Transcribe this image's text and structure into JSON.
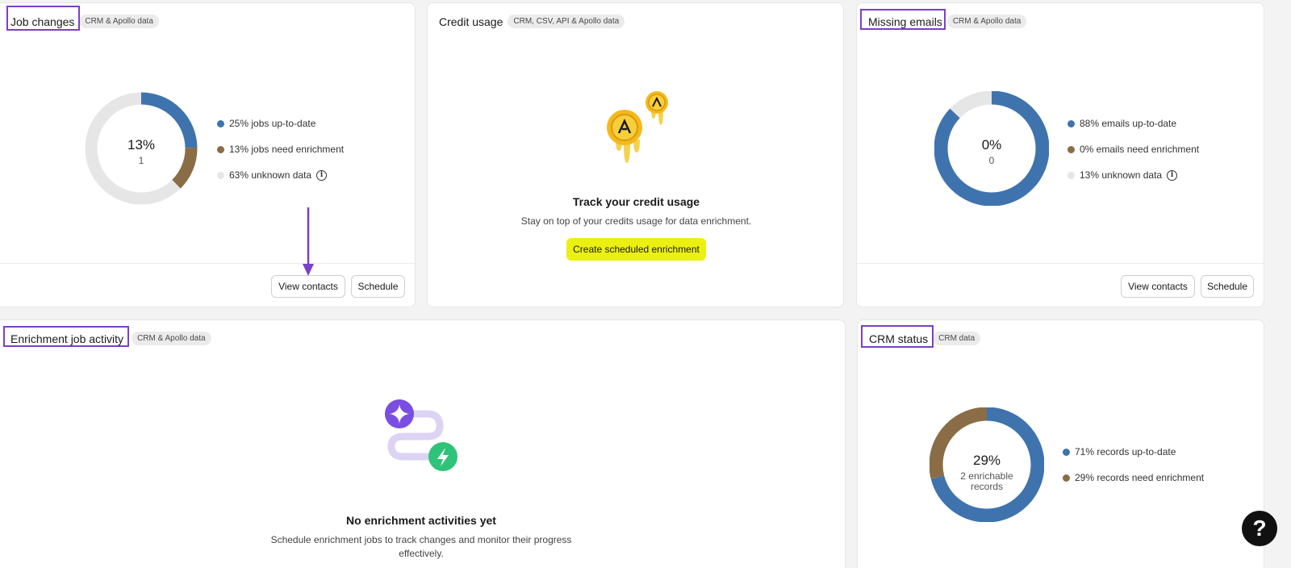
{
  "job_changes": {
    "title": "Job changes",
    "tag": "CRM & Apollo data",
    "center_pct": "13%",
    "center_count": "1",
    "legend": [
      {
        "label": "25% jobs up-to-date",
        "color": "#3f73ae"
      },
      {
        "label": "13% jobs need enrichment",
        "color": "#8a6d46"
      },
      {
        "label": "63% unknown data",
        "color": "#e6e6e6"
      }
    ],
    "chart_data": {
      "type": "pie",
      "categories": [
        "jobs up-to-date",
        "jobs need enrichment",
        "unknown data"
      ],
      "values": [
        25,
        13,
        63
      ]
    },
    "view_contacts_label": "View contacts",
    "schedule_label": "Schedule"
  },
  "credit_usage": {
    "title": "Credit usage",
    "tag": "CRM, CSV, API & Apollo data",
    "empty_title": "Track your credit usage",
    "empty_desc": "Stay on top of your credits usage for data enrichment.",
    "cta_label": "Create scheduled enrichment"
  },
  "missing_emails": {
    "title": "Missing emails",
    "tag": "CRM & Apollo data",
    "center_pct": "0%",
    "center_count": "0",
    "legend": [
      {
        "label": "88% emails up-to-date",
        "color": "#3f73ae"
      },
      {
        "label": "0% emails need enrichment",
        "color": "#8a6d46"
      },
      {
        "label": "13% unknown data",
        "color": "#e6e6e6"
      }
    ],
    "chart_data": {
      "type": "pie",
      "categories": [
        "emails up-to-date",
        "emails need enrichment",
        "unknown data"
      ],
      "values": [
        88,
        0,
        13
      ]
    },
    "view_contacts_label": "View contacts",
    "schedule_label": "Schedule"
  },
  "enrichment_activity": {
    "title": "Enrichment job activity",
    "tag": "CRM & Apollo data",
    "empty_title": "No enrichment activities yet",
    "empty_desc": "Schedule enrichment jobs to track changes and monitor their progress effectively."
  },
  "crm_status": {
    "title": "CRM status",
    "tag": "CRM data",
    "center_pct": "29%",
    "center_sub": "2 enrichable records",
    "legend": [
      {
        "label": "71% records up-to-date",
        "color": "#3f73ae"
      },
      {
        "label": "29% records need enrichment",
        "color": "#8a6d46"
      }
    ],
    "chart_data": {
      "type": "pie",
      "categories": [
        "records up-to-date",
        "records need enrichment"
      ],
      "values": [
        71,
        29
      ]
    }
  },
  "help": {
    "label": "?"
  }
}
